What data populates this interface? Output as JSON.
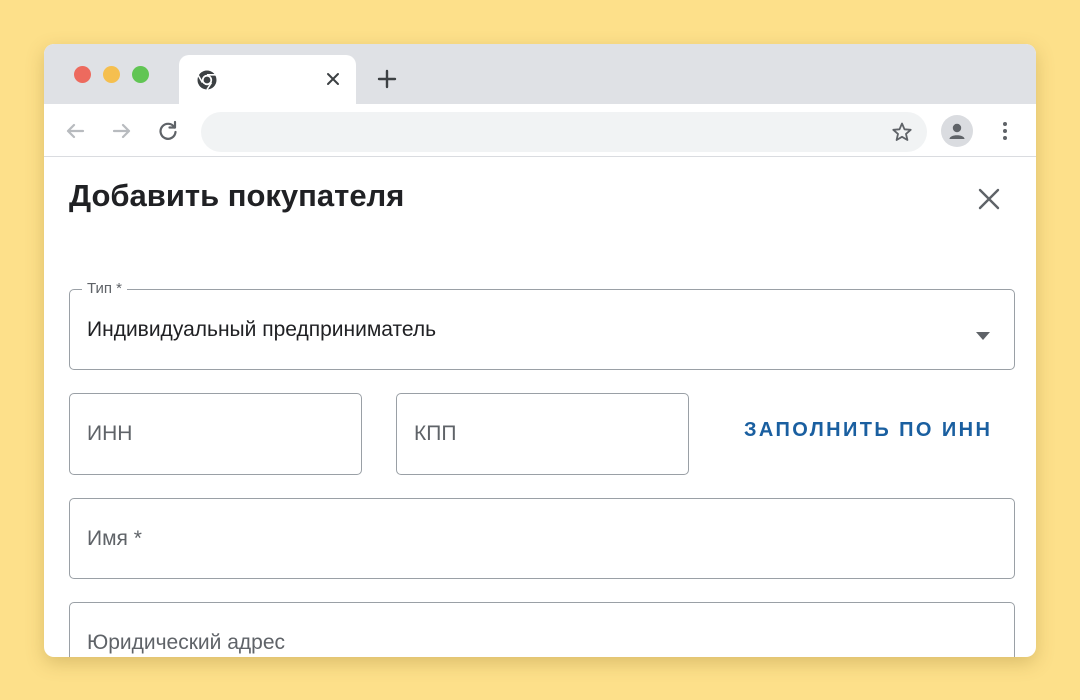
{
  "colors": {
    "page_background": "#fde08a",
    "window_background": "#ffffff",
    "tabstrip_background": "#dfe1e5",
    "accent_link": "#1a5fa0",
    "traffic_red": "#ed6a5e",
    "traffic_yellow": "#f5bf4f",
    "traffic_green": "#61c554"
  },
  "browser": {
    "tab": {
      "favicon": "chrome-icon",
      "close_icon": "close-icon"
    },
    "new_tab_icon": "plus-icon",
    "toolbar": {
      "back_icon": "arrow-left-icon",
      "forward_icon": "arrow-right-icon",
      "reload_icon": "reload-icon",
      "address_value": "",
      "bookmark_icon": "star-icon",
      "profile_icon": "person-icon",
      "menu_icon": "kebab-icon"
    }
  },
  "dialog": {
    "title": "Добавить покупателя",
    "close_icon": "close-icon",
    "type_field": {
      "label": "Тип *",
      "value": "Индивидуальный предприниматель",
      "dropdown_icon": "caret-down-icon"
    },
    "inn_field": {
      "placeholder": "ИНН",
      "value": ""
    },
    "kpp_field": {
      "placeholder": "КПП",
      "value": ""
    },
    "fill_by_inn_button": "ЗАПОЛНИТЬ ПО ИНН",
    "name_field": {
      "placeholder": "Имя *",
      "value": ""
    },
    "legal_address_field": {
      "placeholder": "Юридический адрес",
      "value": ""
    }
  }
}
